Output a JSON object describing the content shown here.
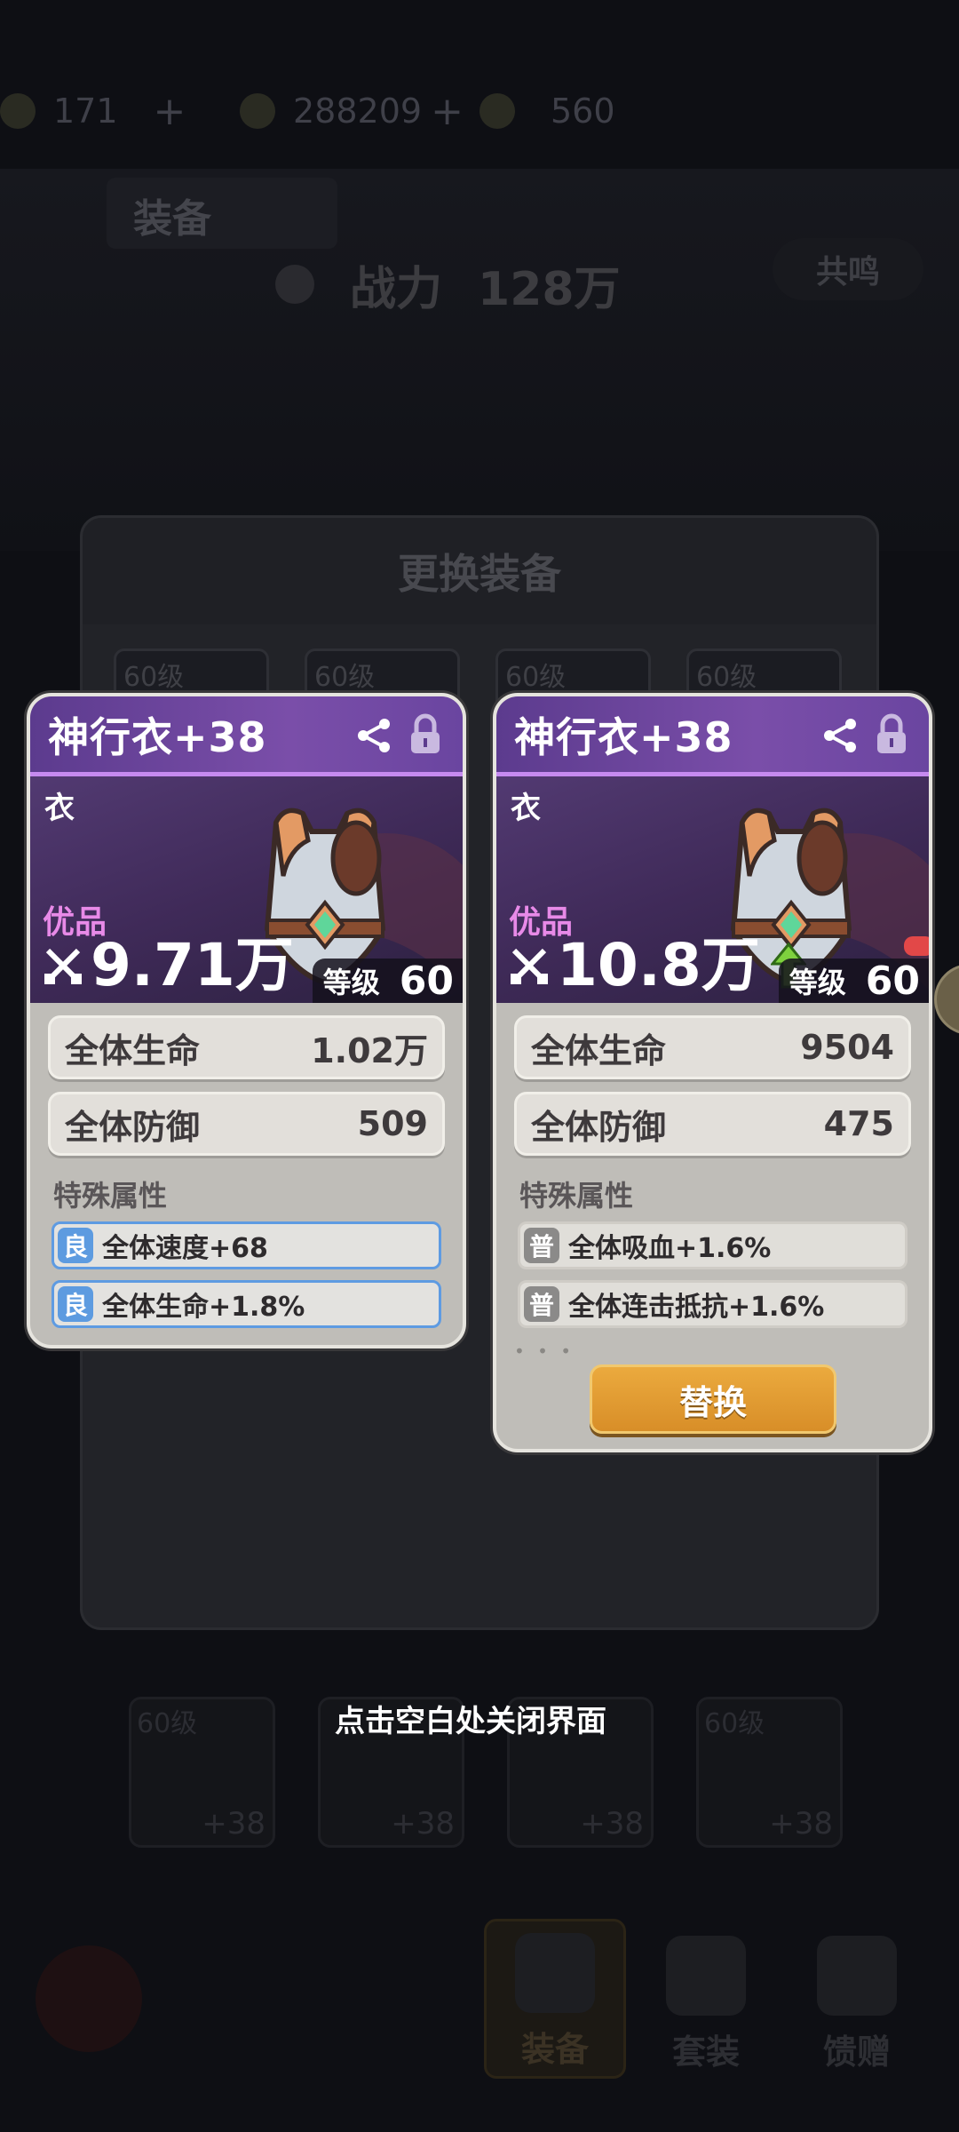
{
  "topbar": {
    "stamina": "171",
    "gold": "288209",
    "gems": "560",
    "plus": "+"
  },
  "header": {
    "tab_equip": "装备",
    "power_label": "战力",
    "power_value": "128万",
    "resonance": "共鸣"
  },
  "panel": {
    "title": "更换装备",
    "slots": [
      "60级",
      "60级",
      "60级",
      "60级"
    ],
    "bottom_slots": [
      {
        "level": "60级",
        "plus": "+38"
      },
      {
        "level": "",
        "plus": "+38"
      },
      {
        "level": "",
        "plus": "+38"
      },
      {
        "level": "60级",
        "plus": "+38"
      }
    ]
  },
  "left_card": {
    "name": "神行衣+38",
    "slot_type": "衣",
    "quality": "优品",
    "power": "9.71万",
    "level_label": "等级",
    "level": "60",
    "stats": [
      {
        "name": "全体生命",
        "value": "1.02万"
      },
      {
        "name": "全体防御",
        "value": "509"
      }
    ],
    "special_title": "特殊属性",
    "special": [
      {
        "badge": "良",
        "text": "全体速度+68"
      },
      {
        "badge": "良",
        "text": "全体生命+1.8%"
      }
    ]
  },
  "right_card": {
    "name": "神行衣+38",
    "slot_type": "衣",
    "quality": "优品",
    "power": "10.8万",
    "level_label": "等级",
    "level": "60",
    "stats": [
      {
        "name": "全体生命",
        "value": "9504"
      },
      {
        "name": "全体防御",
        "value": "475"
      }
    ],
    "special_title": "特殊属性",
    "special": [
      {
        "badge": "普",
        "text": "全体吸血+1.6%"
      },
      {
        "badge": "普",
        "text": "全体连击抵抗+1.6%"
      }
    ],
    "dots": "• • •",
    "replace_button": "替换"
  },
  "close_hint": "点击空白处关闭界面",
  "nav": {
    "equip": "装备",
    "set": "套装",
    "gift": "馈赠"
  },
  "colors": {
    "quality_purple": "#e88ae8",
    "good_badge": "#5d9be0",
    "normal_badge": "#8b8a89",
    "replace_button": "#e3a034"
  }
}
